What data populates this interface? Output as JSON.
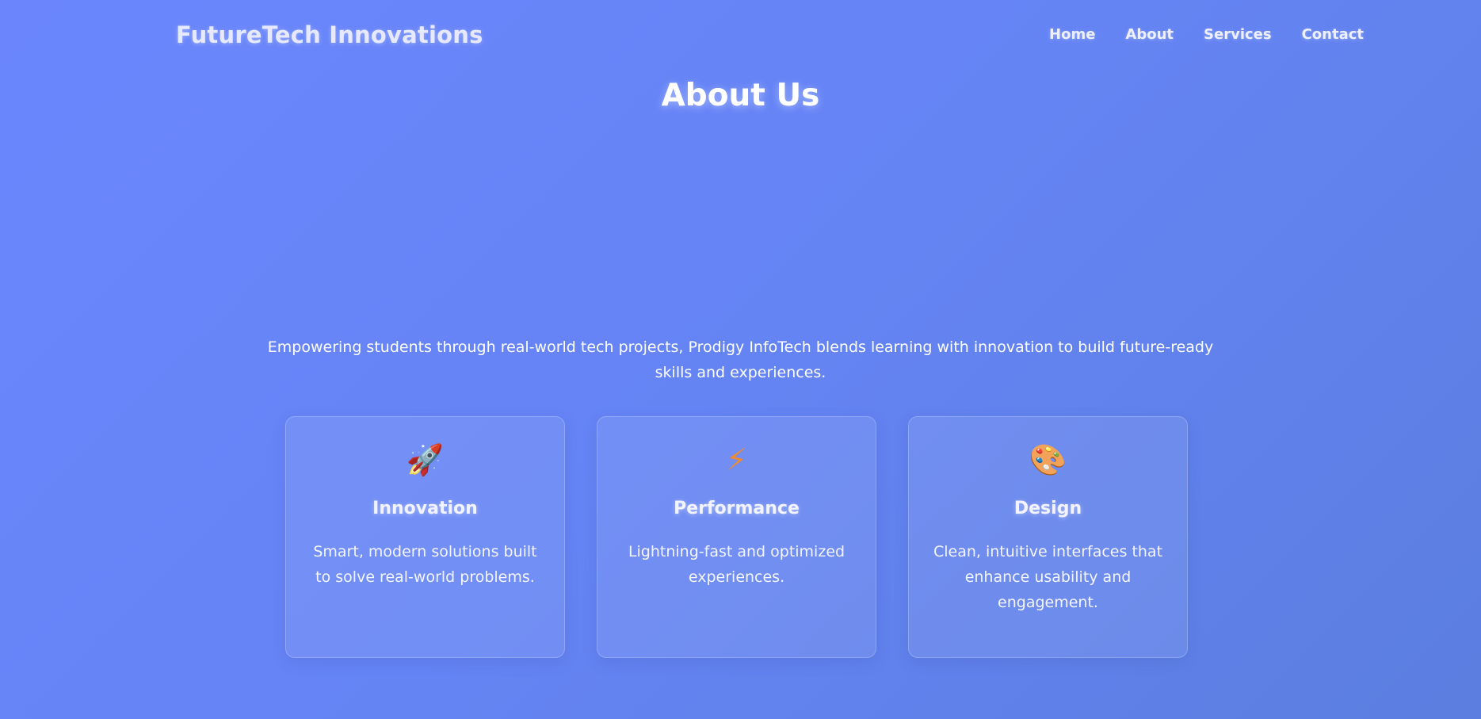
{
  "header": {
    "logo": "FutureTech Innovations",
    "nav": [
      {
        "label": "Home"
      },
      {
        "label": "About"
      },
      {
        "label": "Services"
      },
      {
        "label": "Contact"
      }
    ]
  },
  "about": {
    "title": "About Us",
    "intro": "Empowering students through real-world tech projects, Prodigy InfoTech blends learning with innovation to build future-ready skills and experiences."
  },
  "features": [
    {
      "icon": "rocket-icon",
      "glyph": "🚀",
      "title": "Innovation",
      "text": "Smart, modern solutions built to solve real-world problems."
    },
    {
      "icon": "lightning-bolt-icon",
      "glyph": "⚡",
      "title": "Performance",
      "text": "Lightning-fast and optimized experiences."
    },
    {
      "icon": "palette-icon",
      "glyph": "🎨",
      "title": "Design",
      "text": "Clean, intuitive interfaces that enhance usability and engagement."
    }
  ],
  "colors": {
    "background_start": "#6b86fd",
    "background_end": "#5b7ee0",
    "text": "#ffffff"
  }
}
